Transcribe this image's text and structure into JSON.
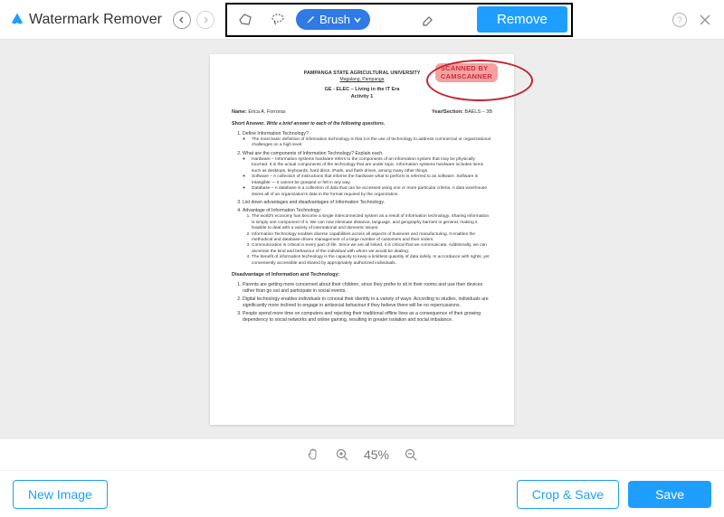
{
  "app": {
    "title": "Watermark Remover"
  },
  "toolbar": {
    "brush_label": "Brush",
    "remove_label": "Remove"
  },
  "zoom": {
    "level": "45%"
  },
  "footer": {
    "new_image": "New Image",
    "crop_save": "Crop & Save",
    "save": "Save"
  },
  "watermark": {
    "line1": "SCANNED BY",
    "line2": "CAMSCANNER"
  },
  "document": {
    "university": "PAMPANGA STATE AGRICULTURAL UNIVERSITY",
    "location": "Magalang, Pampanga",
    "course": "GE - ELEC – Living in the IT Era",
    "activity": "Activity 1",
    "name_label": "Name:",
    "name_value": "Erica A. Forroras",
    "section_label": "Year/Section:",
    "section_value": "BAELS – 3B",
    "short_answer_label": "Short Answer.",
    "short_answer_prompt": "Write a brief answer to each of the following questions.",
    "q1": "Define Information Technology?",
    "q1_a": "The most basic definition of information technology is that it is the use of technology to address commercial or organizational challenges on a high level.",
    "q2": "What are the components of Information Technology? Explain each.",
    "q2_hw": "Hardware – Information systems hardware refers to the components of an information system that may be physically touched. It is the actual components of the technology that are under topic. Information systems hardware includes items such as desktops, keyboards, hard discs, iPads, and flash drives, among many other things.",
    "q2_sw": "Software – A collection of instructions that informs the hardware what to perform is referred to as software. Software is intangible — it cannot be grasped or felt in any way.",
    "q2_db": "Database – A database is a collection of data that can be accessed using one or more particular criteria. A data warehouse stores all of an organization's data in the format required by the organization.",
    "q3": "List down advantages and disadvantages of Information Technology.",
    "adv_header": "Advantage of Information Technology:",
    "adv1": "The world's economy has become a single interconnected system as a result of information technology. Sharing information is simply one component of it. We can now eliminate distance, language, and geography barriers in general, making it feasible to deal with a variety of international and domestic issues.",
    "adv2": "Information Technology enables diverse capabilities across all aspects of business and manufacturing. It enables the methodical and database-driven management of a large number of customers and their orders.",
    "adv3": "Communication is critical in every part of life. Since we are all linked, it is critical that we communicate. Additionally, we can ascertain the kind and behaviour of the individual with whom we would be dealing.",
    "adv4": "The benefit of information technology is the capacity to keep a limitless quantity of data safely. In accordance with rights, yet conveniently accessible and shared by appropriately authorized individuals.",
    "dis_header": "Disadvantage of Information and Technology:",
    "dis1": "Parents are getting more concerned about their children, since they prefer to sit in their rooms and use their devices rather than go out and participate in social events.",
    "dis2": "Digital technology enables individuals to conceal their identity in a variety of ways. According to studies, individuals are significantly more inclined to engage in antisocial behaviour if they believe there will be no repercussions.",
    "dis3": "People spend more time on computers and rejecting their traditional offline lives as a consequence of their growing dependency to social networks and online gaming, resulting in greater isolation and social imbalance."
  }
}
